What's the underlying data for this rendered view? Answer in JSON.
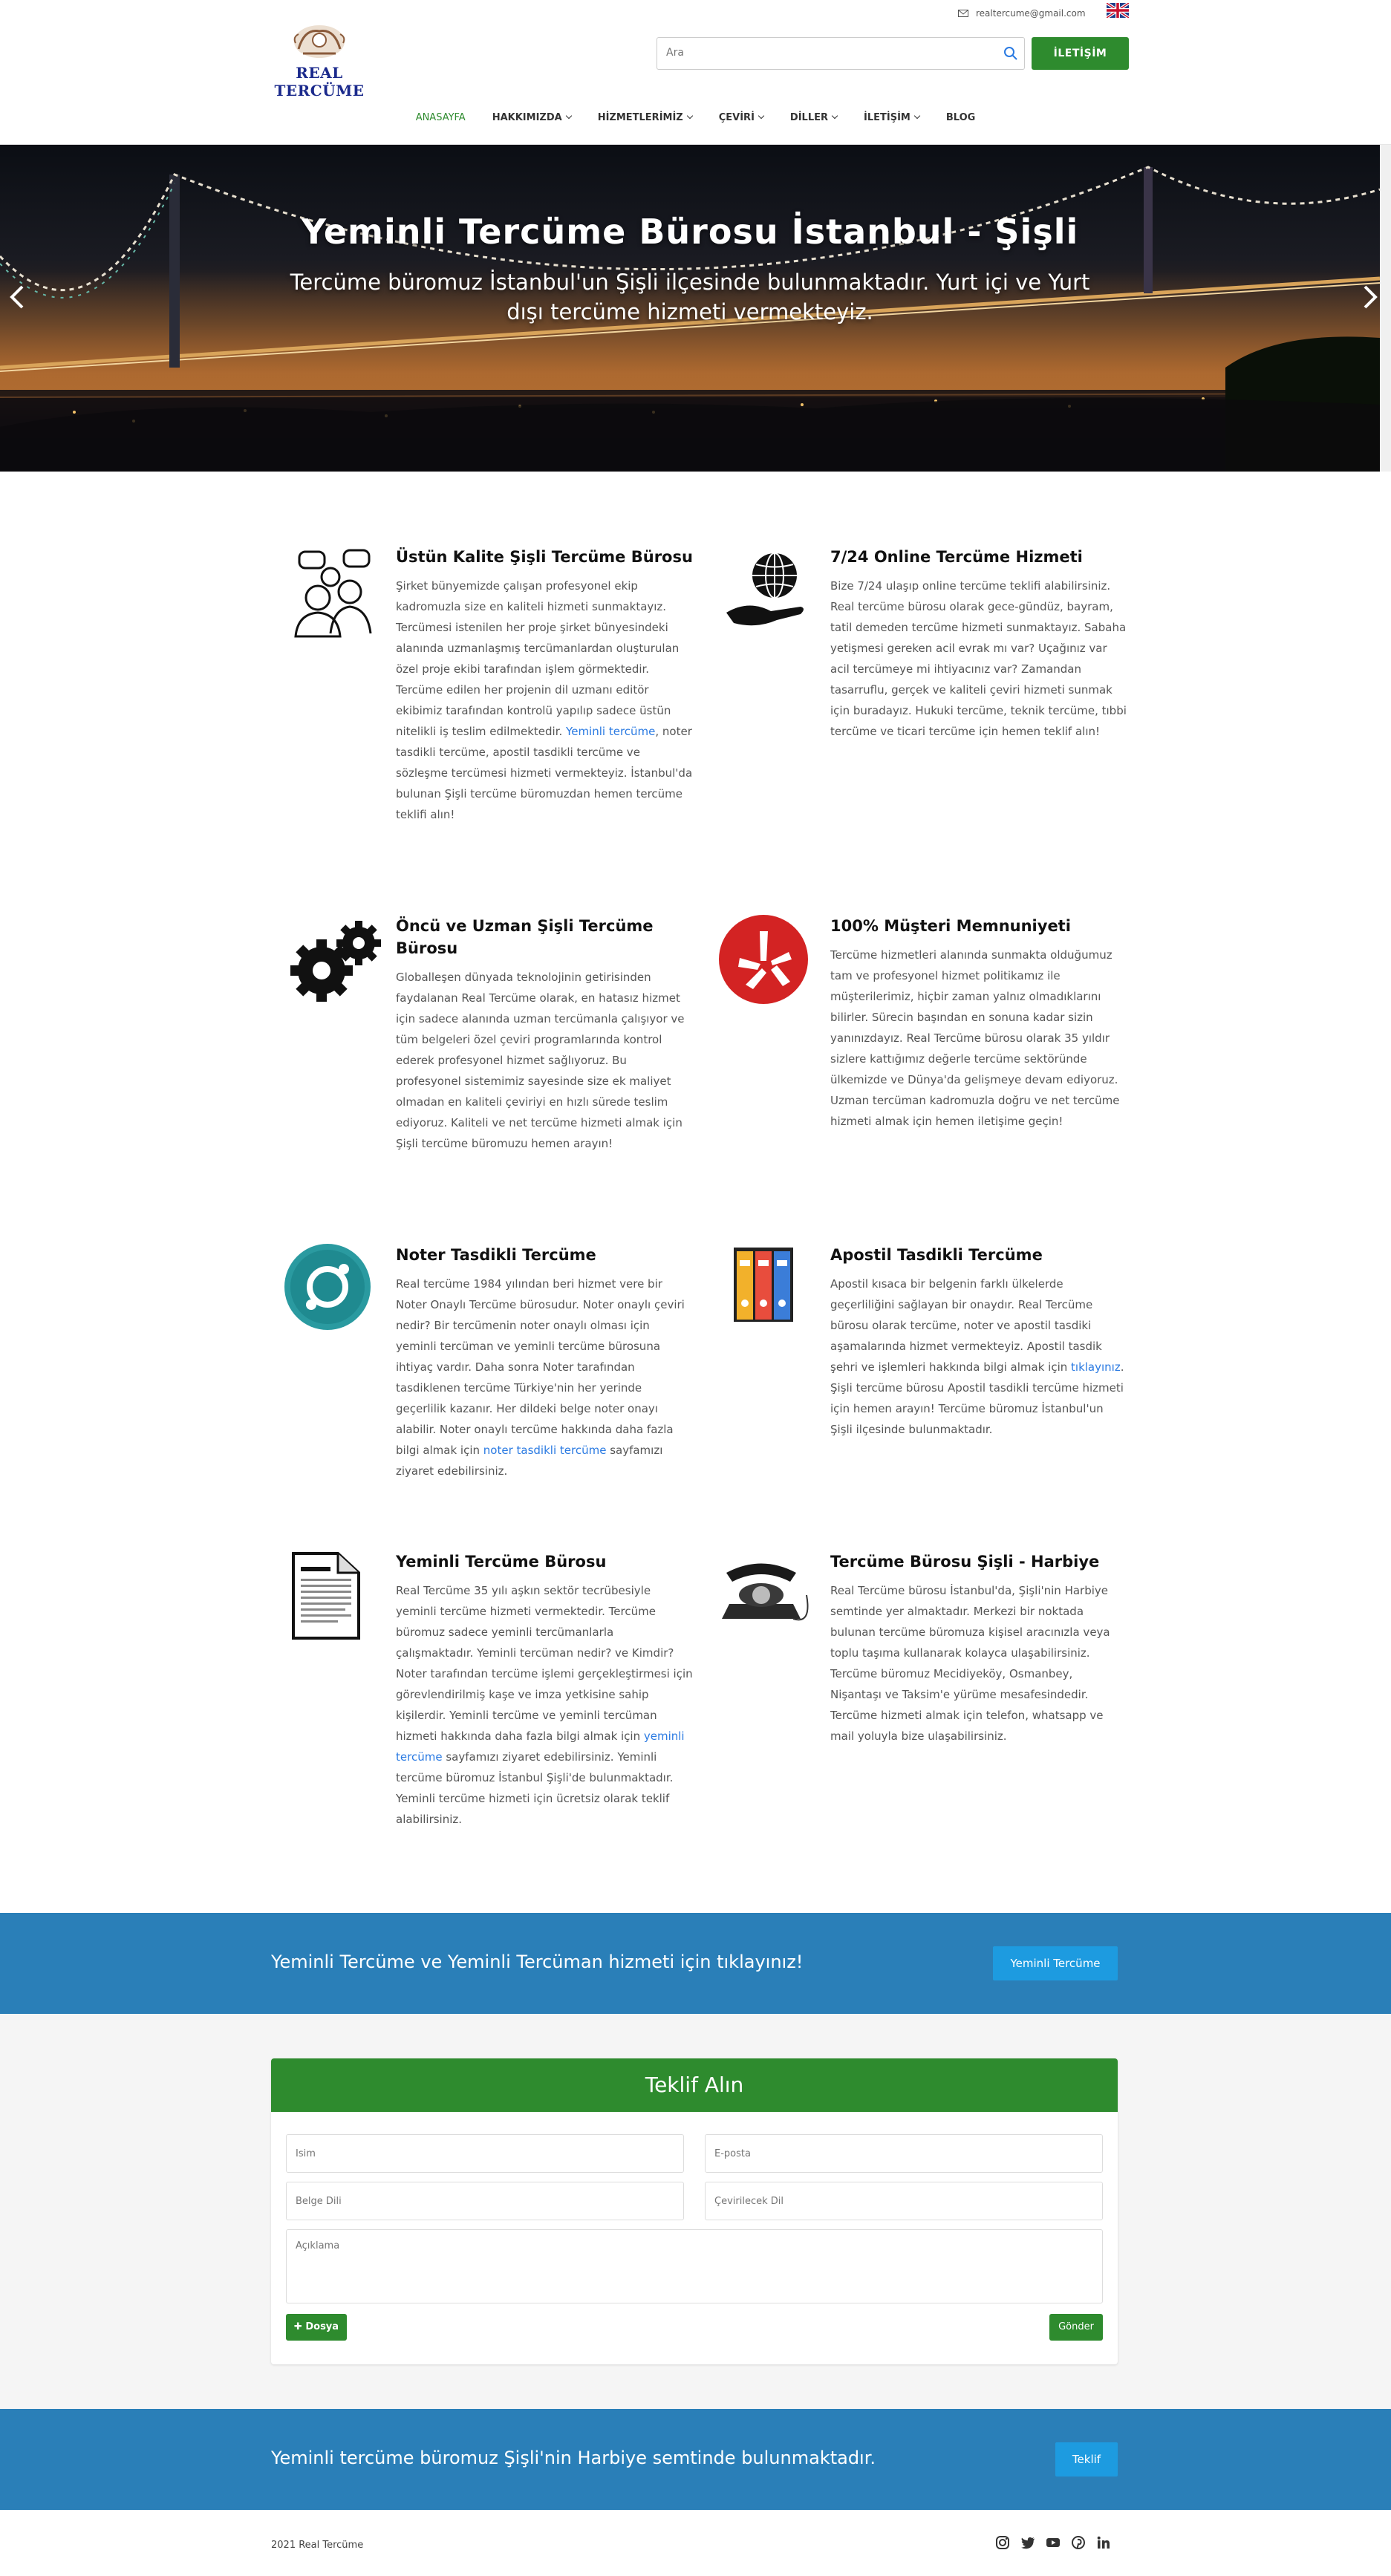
{
  "header": {
    "logo_text": "REAL TERCÜME",
    "email": "realtercume@gmail.com",
    "search_placeholder": "Ara",
    "contact_button": "İLETİŞİM"
  },
  "nav": {
    "items": [
      {
        "label": "ANASAYFA"
      },
      {
        "label": "HAKKIMIZDA"
      },
      {
        "label": "HİZMETLERİMİZ"
      },
      {
        "label": "ÇEVİRİ"
      },
      {
        "label": "DİLLER"
      },
      {
        "label": "İLETİŞİM"
      },
      {
        "label": "BLOG"
      }
    ]
  },
  "hero": {
    "title": "Yeminli Tercüme Bürosu İstanbul - Şişli",
    "subtitle": "Tercüme büromuz İstanbul'un Şişli ilçesinde bulunmaktadır. Yurt içi ve Yurt dışı tercüme hizmeti vermekteyiz."
  },
  "features": [
    {
      "title": "Üstün Kalite Şişli Tercüme Bürosu",
      "text_before": "Şirket bünyemizde çalışan profesyonel ekip kadromuzla size en kaliteli hizmeti sunmaktayız. Tercümesi istenilen her proje şirket bünyesindeki alanında uzmanlaşmış tercümanlardan oluşturulan özel proje ekibi tarafından işlem görmektedir. Tercüme edilen her projenin dil uzmanı editör ekibimiz tarafından kontrolü yapılıp sadece üstün nitelikli iş teslim edilmektedir. ",
      "link": "Yeminli tercüme",
      "text_after": ", noter tasdikli tercüme, apostil tasdikli tercüme ve sözleşme tercümesi hizmeti vermekteyiz. İstanbul'da bulunan Şişli tercüme büromuzdan hemen tercüme teklifi alın!"
    },
    {
      "title": "7/24 Online Tercüme Hizmeti",
      "text": "Bize 7/24 ulaşıp online tercüme teklifi alabilirsiniz. Real tercüme bürosu olarak gece-gündüz, bayram, tatil demeden tercüme hizmeti sunmaktayız. Sabaha yetişmesi gereken acil evrak mı var? Uçağınız var acil tercümeye mi ihtiyacınız var? Zamandan tasarruflu, gerçek ve kaliteli çeviri hizmeti sunmak için buradayız. Hukuki tercüme, teknik tercüme, tıbbi tercüme ve ticari tercüme için hemen teklif alın!"
    },
    {
      "title": "Öncü ve Uzman Şişli Tercüme Bürosu",
      "text": "Globalleşen dünyada teknolojinin getirisinden faydalanan Real Tercüme olarak, en hatasız hizmet için sadece alanında uzman tercümanla çalışıyor ve tüm belgeleri özel çeviri programlarında kontrol ederek profesyonel hizmet sağlıyoruz. Bu profesyonel sistemimiz sayesinde size ek maliyet olmadan en kaliteli çeviriyi en hızlı sürede teslim ediyoruz. Kaliteli ve net tercüme hizmeti almak için Şişli tercüme büromuzu hemen arayın!"
    },
    {
      "title": "100% Müşteri Memnuniyeti",
      "text": "Tercüme hizmetleri alanında sunmakta olduğumuz tam ve profesyonel hizmet politikamız ile müşterilerimiz, hiçbir zaman yalnız olmadıklarını bilirler. Sürecin başından en sonuna kadar sizin yanınızdayız. Real Tercüme bürosu olarak 35 yıldır sizlere kattığımız değerle tercüme sektöründe ülkemizde ve Dünya'da gelişmeye devam ediyoruz. Uzman tercüman kadromuzla doğru ve net tercüme hizmeti almak için hemen iletişime geçin!"
    },
    {
      "title": "Noter Tasdikli Tercüme",
      "text_before": "Real tercüme 1984 yılından beri hizmet vere bir Noter Onaylı Tercüme bürosudur. Noter onaylı çeviri nedir? Bir tercümenin noter onaylı olması için yeminli tercüman ve yeminli tercüme bürosuna ihtiyaç vardır. Daha sonra Noter tarafından tasdiklenen tercüme Türkiye'nin her yerinde geçerlilik kazanır. Her dildeki belge noter onayı alabilir. Noter onaylı tercüme hakkında daha fazla bilgi almak için ",
      "link": "noter tasdikli tercüme",
      "text_after": " sayfamızı ziyaret edebilirsiniz."
    },
    {
      "title": "Apostil Tasdikli Tercüme",
      "text_before": "Apostil kısaca bir belgenin farklı ülkelerde geçerliliğini sağlayan bir onaydır. Real Tercüme bürosu olarak tercüme, noter ve apostil tasdiki aşamalarında hizmet vermekteyiz. Apostil tasdik şehri ve işlemleri hakkında bilgi almak için ",
      "link": "tıklayınız",
      "text_after": ". Şişli tercüme bürosu Apostil tasdikli tercüme hizmeti için hemen arayın! Tercüme büromuz İstanbul'un Şişli ilçesinde bulunmaktadır."
    },
    {
      "title": "Yeminli Tercüme Bürosu",
      "text_before": "Real Tercüme 35 yılı aşkın sektör tecrübesiyle yeminli tercüme hizmeti vermektedir. Tercüme büromuz sadece yeminli tercümanlarla çalışmaktadır. Yeminli tercüman nedir? ve Kimdir? Noter tarafından tercüme işlemi gerçekleştirmesi için görevlendirilmiş kaşe ve imza yetkisine sahip kişilerdir. Yeminli tercüme ve yeminli tercüman hizmeti hakkında daha fazla bilgi almak için ",
      "link": "yeminli tercüme",
      "text_after": " sayfamızı ziyaret edebilirsiniz. Yeminli tercüme büromuz İstanbul Şişli'de bulunmaktadır. Yeminli tercüme hizmeti için ücretsiz olarak teklif alabilirsiniz."
    },
    {
      "title": "Tercüme Bürosu Şişli - Harbiye",
      "text": "Real Tercüme bürosu İstanbul'da, Şişli'nin Harbiye semtinde yer almaktadır. Merkezi bir noktada bulunan tercüme büromuza kişisel aracınızla veya toplu taşıma kullanarak kolayca ulaşabilirsiniz. Tercüme büromuz Mecidiyeköy, Osmanbey, Nişantaşı ve Taksim'e yürüme mesafesindedir. Tercüme hizmeti almak için telefon, whatsapp ve mail yoluyla bize ulaşabilirsiniz."
    }
  ],
  "cta1": {
    "text": "Yeminli Tercüme ve Yeminli Tercüman hizmeti için tıklayınız!",
    "button": "Yeminli Tercüme"
  },
  "form": {
    "title": "Teklif Alın",
    "name_placeholder": "İsim",
    "email_placeholder": "E-posta",
    "source_lang_placeholder": "Belge Dili",
    "target_lang_placeholder": "Çevirilecek Dil",
    "desc_placeholder": "Açıklama",
    "file_button": "Dosya",
    "submit_button": "Gönder"
  },
  "cta2": {
    "text": "Yeminli tercüme büromuz Şişli'nin Harbiye semtinde bulunmaktadır.",
    "button": "Teklif"
  },
  "footer": {
    "copyright": "2021 Real Tercüme",
    "socials": [
      "instagram-icon",
      "twitter-icon",
      "youtube-icon",
      "pinterest-icon",
      "linkedin-icon"
    ]
  },
  "colors": {
    "brand_green": "#2e8b2e",
    "band_blue": "#2a7fb8",
    "button_blue": "#1d9be0",
    "link_blue": "#2a7ae2",
    "logo_blue": "#1b2a8c"
  }
}
